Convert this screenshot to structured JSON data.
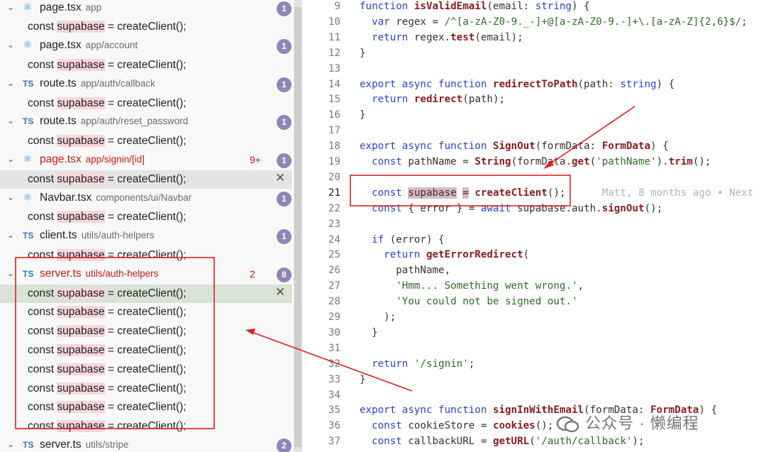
{
  "search_results": [
    {
      "kind": "file",
      "icon": "react",
      "icon_name": "react-icon",
      "name": "page.tsx",
      "path": "app",
      "badge": "1"
    },
    {
      "kind": "match",
      "pre": "const ",
      "hl": "supabase",
      "post": " = createClient();"
    },
    {
      "kind": "file",
      "icon": "react",
      "icon_name": "react-icon",
      "name": "page.tsx",
      "path": "app/account",
      "badge": "1"
    },
    {
      "kind": "match",
      "pre": "const ",
      "hl": "supabase",
      "post": " = createClient();"
    },
    {
      "kind": "file",
      "icon": "ts",
      "icon_name": "typescript-icon",
      "name": "route.ts",
      "path": "app/auth/callback",
      "badge": "1"
    },
    {
      "kind": "match",
      "pre": "const ",
      "hl": "supabase",
      "post": " = createClient();"
    },
    {
      "kind": "file",
      "icon": "ts",
      "icon_name": "typescript-icon",
      "name": "route.ts",
      "path": "app/auth/reset_password",
      "badge": "1"
    },
    {
      "kind": "match",
      "pre": "const ",
      "hl": "supabase",
      "post": " = createClient();"
    },
    {
      "kind": "file",
      "icon": "react",
      "icon_name": "react-icon",
      "name": "page.tsx",
      "path": "app/signin/[id]",
      "badge": "1",
      "error": true,
      "errors": "9+"
    },
    {
      "kind": "match",
      "pre": "const ",
      "hl": "supabase",
      "post": " = createClient();",
      "selected": "gray",
      "close": true
    },
    {
      "kind": "file",
      "icon": "react",
      "icon_name": "react-icon",
      "name": "Navbar.tsx",
      "path": "components/ui/Navbar",
      "badge": "1"
    },
    {
      "kind": "match",
      "pre": "const ",
      "hl": "supabase",
      "post": " = createClient();"
    },
    {
      "kind": "file",
      "icon": "ts",
      "icon_name": "typescript-icon",
      "name": "client.ts",
      "path": "utils/auth-helpers",
      "badge": "1"
    },
    {
      "kind": "match",
      "pre": "const ",
      "hl": "supabase",
      "post": " = createClient();"
    },
    {
      "kind": "file",
      "icon": "ts",
      "icon_name": "typescript-icon",
      "name": "server.ts",
      "path": "utils/auth-helpers",
      "badge": "8",
      "error": true,
      "errors": "2"
    },
    {
      "kind": "match",
      "pre": "const ",
      "hl": "supabase",
      "post": " = createClient();",
      "selected": "green",
      "close": true
    },
    {
      "kind": "match",
      "pre": "const ",
      "hl": "supabase",
      "post": " = createClient();"
    },
    {
      "kind": "match",
      "pre": "const ",
      "hl": "supabase",
      "post": " = createClient();"
    },
    {
      "kind": "match",
      "pre": "const ",
      "hl": "supabase",
      "post": " = createClient();"
    },
    {
      "kind": "match",
      "pre": "const ",
      "hl": "supabase",
      "post": " = createClient();"
    },
    {
      "kind": "match",
      "pre": "const ",
      "hl": "supabase",
      "post": " = createClient();"
    },
    {
      "kind": "match",
      "pre": "const ",
      "hl": "supabase",
      "post": " = createClient();"
    },
    {
      "kind": "match",
      "pre": "const ",
      "hl": "supabase",
      "post": " = createClient();"
    },
    {
      "kind": "file",
      "icon": "ts",
      "icon_name": "typescript-icon",
      "name": "server.ts",
      "path": "utils/stripe",
      "badge": "2"
    }
  ],
  "icons": {
    "chevron": "chevron-down-icon",
    "close": "close-icon",
    "ts_label": "TS"
  },
  "editor": {
    "current_line": 21,
    "blame": "Matt, 8 months ago • Next",
    "lines": [
      {
        "n": 9,
        "t": [
          [
            "kw",
            "function "
          ],
          [
            "fn",
            "isValidEmail"
          ],
          [
            "pn",
            "(email: "
          ],
          [
            "ty",
            "string"
          ],
          [
            "pn",
            ") {"
          ]
        ]
      },
      {
        "n": 10,
        "t": [
          [
            "pn",
            "  "
          ],
          [
            "kw",
            "var "
          ],
          [
            "pn",
            "regex = "
          ],
          [
            "str",
            "/^[a-zA-Z0-9._-]+@[a-zA-Z0-9.-]+\\.[a-zA-Z]{2,6}$/"
          ],
          [
            "pn",
            ";"
          ]
        ]
      },
      {
        "n": 11,
        "t": [
          [
            "pn",
            "  "
          ],
          [
            "kw",
            "return "
          ],
          [
            "pn",
            "regex."
          ],
          [
            "fn",
            "test"
          ],
          [
            "pn",
            "(email);"
          ]
        ]
      },
      {
        "n": 12,
        "t": [
          [
            "pn",
            "}"
          ]
        ]
      },
      {
        "n": 13,
        "t": []
      },
      {
        "n": 14,
        "t": [
          [
            "kw",
            "export async function "
          ],
          [
            "fn",
            "redirectToPath"
          ],
          [
            "pn",
            "(path: "
          ],
          [
            "ty",
            "string"
          ],
          [
            "pn",
            ") {"
          ]
        ]
      },
      {
        "n": 15,
        "t": [
          [
            "pn",
            "  "
          ],
          [
            "kw",
            "return "
          ],
          [
            "fn",
            "redirect"
          ],
          [
            "pn",
            "(path);"
          ]
        ]
      },
      {
        "n": 16,
        "t": [
          [
            "pn",
            "}"
          ]
        ]
      },
      {
        "n": 17,
        "t": []
      },
      {
        "n": 18,
        "t": [
          [
            "kw",
            "export async function "
          ],
          [
            "fn",
            "SignOut"
          ],
          [
            "pn",
            "(formData: "
          ],
          [
            "fn",
            "FormData"
          ],
          [
            "pn",
            ") {"
          ]
        ]
      },
      {
        "n": 19,
        "t": [
          [
            "pn",
            "  "
          ],
          [
            "kw",
            "const "
          ],
          [
            "pn",
            "pathName = "
          ],
          [
            "fn",
            "String"
          ],
          [
            "pn",
            "(formData."
          ],
          [
            "fn",
            "get"
          ],
          [
            "pn",
            "("
          ],
          [
            "str",
            "'pathName'"
          ],
          [
            "pn",
            ")."
          ],
          [
            "fn",
            "trim"
          ],
          [
            "pn",
            "();"
          ]
        ]
      },
      {
        "n": 20,
        "t": []
      },
      {
        "n": 21,
        "t": [
          [
            "pn",
            "  "
          ],
          [
            "kw",
            "const "
          ],
          [
            "hlv",
            "supabase"
          ],
          [
            "pn",
            " "
          ],
          [
            "hlv",
            "="
          ],
          [
            "pn",
            " "
          ],
          [
            "fn",
            "createClient"
          ],
          [
            "pn",
            "();"
          ]
        ]
      },
      {
        "n": 22,
        "t": [
          [
            "pn",
            "  "
          ],
          [
            "kw",
            "const "
          ],
          [
            "pn",
            "{ error } = "
          ],
          [
            "kw",
            "await "
          ],
          [
            "pn",
            "supabase.auth."
          ],
          [
            "fn",
            "signOut"
          ],
          [
            "pn",
            "();"
          ]
        ]
      },
      {
        "n": 23,
        "t": []
      },
      {
        "n": 24,
        "t": [
          [
            "pn",
            "  "
          ],
          [
            "kw",
            "if "
          ],
          [
            "pn",
            "(error) {"
          ]
        ]
      },
      {
        "n": 25,
        "t": [
          [
            "pn",
            "    "
          ],
          [
            "kw",
            "return "
          ],
          [
            "fn",
            "getErrorRedirect"
          ],
          [
            "pn",
            "("
          ]
        ]
      },
      {
        "n": 26,
        "t": [
          [
            "pn",
            "      pathName,"
          ]
        ]
      },
      {
        "n": 27,
        "t": [
          [
            "pn",
            "      "
          ],
          [
            "str",
            "'Hmm... Something went wrong.'"
          ],
          [
            "pn",
            ","
          ]
        ]
      },
      {
        "n": 28,
        "t": [
          [
            "pn",
            "      "
          ],
          [
            "str",
            "'You could not be signed out.'"
          ]
        ]
      },
      {
        "n": 29,
        "t": [
          [
            "pn",
            "    );"
          ]
        ]
      },
      {
        "n": 30,
        "t": [
          [
            "pn",
            "  }"
          ]
        ]
      },
      {
        "n": 31,
        "t": []
      },
      {
        "n": 32,
        "t": [
          [
            "pn",
            "  "
          ],
          [
            "kw",
            "return "
          ],
          [
            "str",
            "'/signin'"
          ],
          [
            "pn",
            ";"
          ]
        ]
      },
      {
        "n": 33,
        "t": [
          [
            "pn",
            "}"
          ]
        ]
      },
      {
        "n": 34,
        "t": []
      },
      {
        "n": 35,
        "t": [
          [
            "kw",
            "export async function "
          ],
          [
            "fn",
            "signInWithEmail"
          ],
          [
            "pn",
            "(formData: "
          ],
          [
            "fn",
            "FormData"
          ],
          [
            "pn",
            ") {"
          ]
        ]
      },
      {
        "n": 36,
        "t": [
          [
            "pn",
            "  "
          ],
          [
            "kw",
            "const "
          ],
          [
            "pn",
            "cookieStore = "
          ],
          [
            "fn",
            "cookies"
          ],
          [
            "pn",
            "();"
          ]
        ]
      },
      {
        "n": 37,
        "t": [
          [
            "pn",
            "  "
          ],
          [
            "kw",
            "const "
          ],
          [
            "pn",
            "callbackURL = "
          ],
          [
            "fn",
            "getURL"
          ],
          [
            "pn",
            "("
          ],
          [
            "str",
            "'/auth/callback'"
          ],
          [
            "pn",
            ");"
          ]
        ]
      }
    ]
  },
  "annotation_color": "#e02020",
  "watermark": "公众号 · 懒编程"
}
